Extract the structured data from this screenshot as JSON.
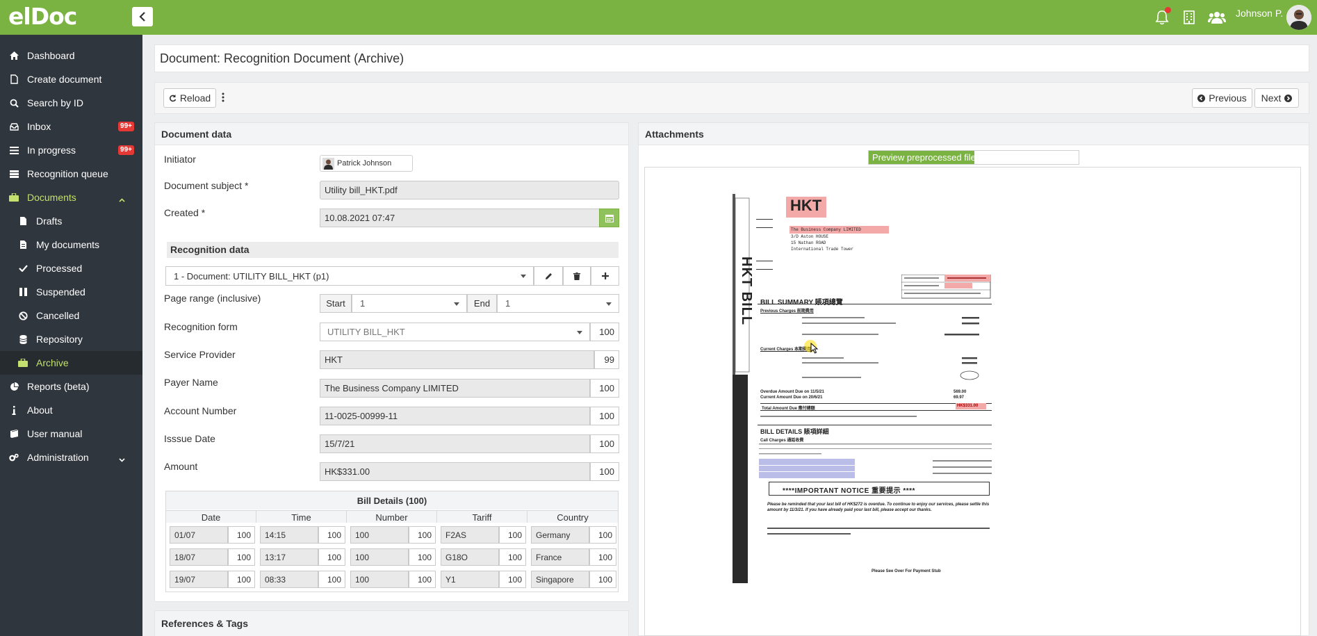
{
  "app": {
    "logo": "elDoc",
    "user_name": "Johnson P."
  },
  "sidebar": {
    "items": [
      {
        "label": "Dashboard",
        "icon": "home-icon"
      },
      {
        "label": "Create document",
        "icon": "file-icon"
      },
      {
        "label": "Search by ID",
        "icon": "search-icon"
      },
      {
        "label": "Inbox",
        "icon": "inbox-icon",
        "badge": "99+"
      },
      {
        "label": "In progress",
        "icon": "list-icon",
        "badge": "99+"
      },
      {
        "label": "Recognition queue",
        "icon": "queue-icon"
      },
      {
        "label": "Documents",
        "icon": "briefcase-icon"
      },
      {
        "label": "Drafts",
        "icon": "draft-icon"
      },
      {
        "label": "My documents",
        "icon": "file-icon"
      },
      {
        "label": "Processed",
        "icon": "check-icon"
      },
      {
        "label": "Suspended",
        "icon": "pause-icon"
      },
      {
        "label": "Cancelled",
        "icon": "ban-icon"
      },
      {
        "label": "Repository",
        "icon": "database-icon"
      },
      {
        "label": "Archive",
        "icon": "archive-icon"
      },
      {
        "label": "Reports (beta)",
        "icon": "pie-chart-icon"
      },
      {
        "label": "About",
        "icon": "info-icon"
      },
      {
        "label": "User manual",
        "icon": "book-icon"
      },
      {
        "label": "Administration",
        "icon": "cogs-icon"
      }
    ]
  },
  "page": {
    "title": "Document: Recognition Document (Archive)"
  },
  "toolbar": {
    "reload": "Reload",
    "previous": "Previous",
    "next": "Next"
  },
  "document_data": {
    "header": "Document data",
    "initiator_label": "Initiator",
    "initiator_value": "Patrick Johnson",
    "subject_label": "Document subject *",
    "subject_value": "Utility bill_HKT.pdf",
    "created_label": "Created *",
    "created_value": "10.08.2021 07:47"
  },
  "recognition": {
    "header": "Recognition data",
    "document_select": "1 - Document: UTILITY BILL_HKT (p1)",
    "page_range_label": "Page range (inclusive)",
    "start_label": "Start",
    "start_value": "1",
    "end_label": "End",
    "end_value": "1",
    "form_label": "Recognition form",
    "form_value": "UTILITY BILL_HKT",
    "form_conf": "100",
    "fields": [
      {
        "label": "Service Provider",
        "value": "HKT",
        "conf": "99"
      },
      {
        "label": "Payer Name",
        "value": "The Business Company LIMITED",
        "conf": "100"
      },
      {
        "label": "Account Number",
        "value": "11-0025-00999-11",
        "conf": "100"
      },
      {
        "label": "Isssue Date",
        "value": "15/7/21",
        "conf": "100"
      },
      {
        "label": "Amount",
        "value": "HK$331.00",
        "conf": "100"
      }
    ],
    "bill_details": {
      "title": "Bill Details (100)",
      "columns": [
        "Date",
        "Time",
        "Number",
        "Tariff",
        "Country"
      ],
      "rows": [
        [
          [
            "01/07",
            "100"
          ],
          [
            "14:15",
            "100"
          ],
          [
            "100",
            "100"
          ],
          [
            "F2AS",
            "100"
          ],
          [
            "Germany",
            "100"
          ]
        ],
        [
          [
            "18/07",
            "100"
          ],
          [
            "13:17",
            "100"
          ],
          [
            "100",
            "100"
          ],
          [
            "G18O",
            "100"
          ],
          [
            "France",
            "100"
          ]
        ],
        [
          [
            "19/07",
            "100"
          ],
          [
            "08:33",
            "100"
          ],
          [
            "100",
            "100"
          ],
          [
            "Y1",
            "100"
          ],
          [
            "Singapore",
            "100"
          ]
        ]
      ]
    }
  },
  "references": {
    "header": "References & Tags"
  },
  "attachments": {
    "header": "Attachments",
    "preview_label": "Preview preprocessed file"
  },
  "doc_image": {
    "brand": "HKT",
    "side_text": "HKT BILL",
    "company": "The Business Company LIMITED",
    "address": [
      "3/D Aston HOUSE",
      "15 Nathan ROAD",
      "International Trade Tower"
    ],
    "bill_summary": "BILL SUMMARY 賬項總覽",
    "previous_charges": "Previous Charges 前期費用",
    "current_charges": "Current Charges 本期費用",
    "overdue": "Overdue Amount Due on 11/5/21",
    "current_due": "Current Amount Due on 20/6/21",
    "total": "Total Amount Due 應付總額",
    "total_value": "HK$331.00",
    "bill_details": "BILL DETAILS 賬項詳細",
    "call_charges": "Call Charges 通話收費",
    "important": "****IMPORTANT NOTICE 重要提示 ****",
    "notice": "Please be reminded that your last bill of HK$272 is overdue. To continue to enjoy our services, please settle this amount by 11/3/21. If you have already paid your last bill, please accept our thanks.",
    "footer": "Please See Over For Payment Stub",
    "amounts": [
      "569.00",
      "69.97"
    ],
    "table_rows": [
      [
        "16/07",
        "Germany"
      ],
      [
        "18/07",
        "France"
      ],
      [
        "19/07",
        "Singapore"
      ]
    ]
  }
}
